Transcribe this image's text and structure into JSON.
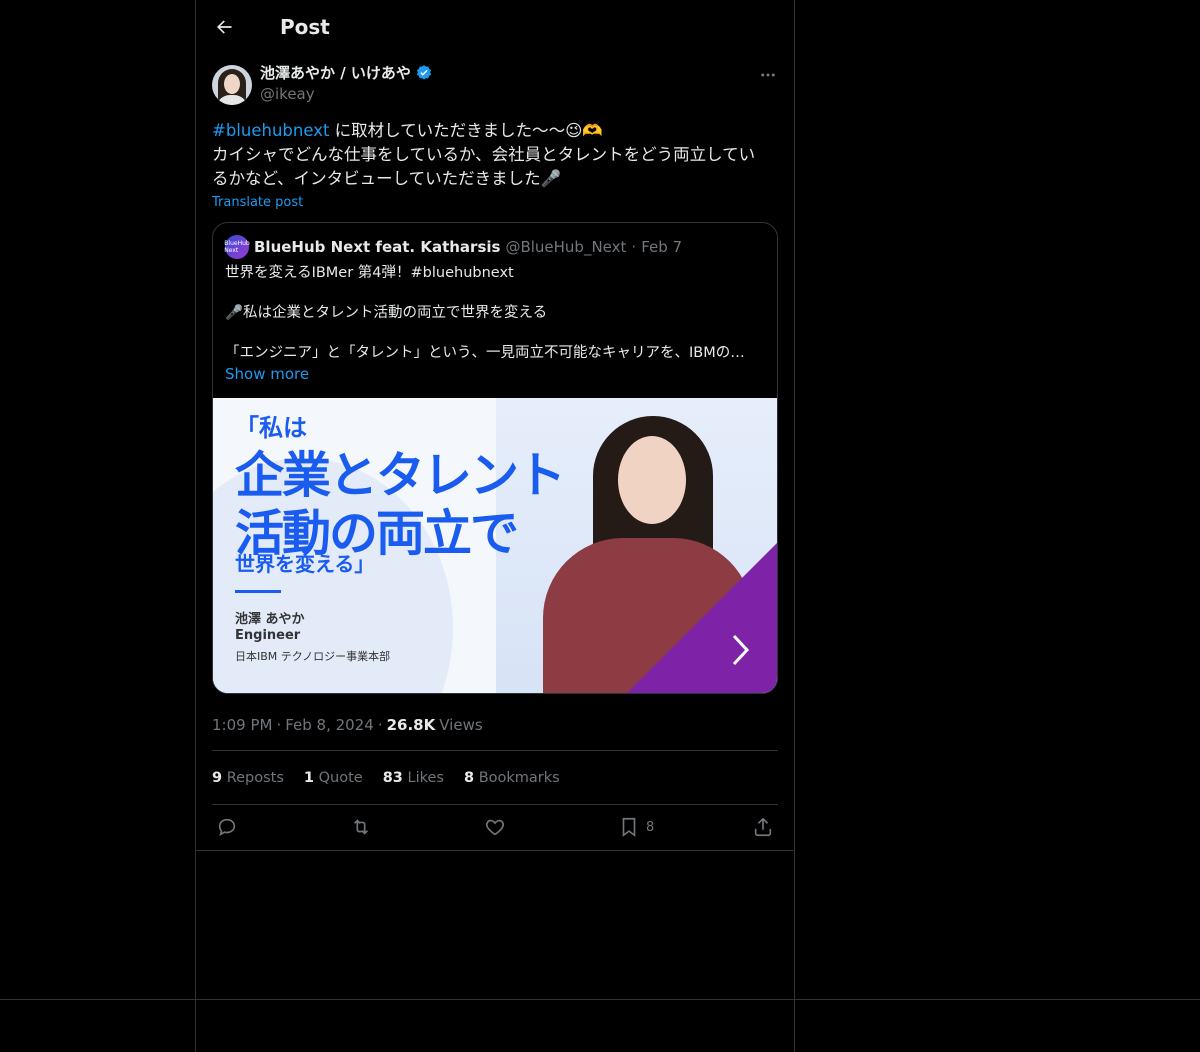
{
  "header": {
    "title": "Post"
  },
  "author": {
    "name": "池澤あやか / いけあや",
    "handle": "@ikeay",
    "verified": true
  },
  "post": {
    "hashtag": "#bluehubnext",
    "line1_rest": " に取材していただきました〜〜😉🫶",
    "line2": "カイシャでどんな仕事をしているか、会社員とタレントをどう両立してい",
    "line3": "るかなど、インタビューしていただきました🎤",
    "translate_label": "Translate post"
  },
  "quote": {
    "name": "BlueHub Next feat. Katharsis",
    "handle": "@BlueHub_Next",
    "separator": "·",
    "date": "Feb 7",
    "avatar_text": "BlueHub Next",
    "line1": "世界を変えるIBMer 第4弾！#bluehubnext",
    "line2": "🎤私は企業とタレント活動の両立で世界を変える",
    "line3": "「エンジニア」と「タレント」という、一見両立不可能なキャリアを、IBMの…",
    "show_more": "Show more"
  },
  "banner": {
    "open_quote": "「私は",
    "line1": "企業とタレント",
    "line2": "活動の両立で",
    "line3": "世界を変える」",
    "name": "池澤 あやか",
    "role": "Engineer",
    "dept": "日本IBM テクノロジー事業本部"
  },
  "meta": {
    "time": "1:09 PM",
    "sep1": "·",
    "date": "Feb 8, 2024",
    "sep2": "·",
    "views_count": "26.8K",
    "views_label": "Views"
  },
  "stats": {
    "reposts_count": "9",
    "reposts_label": "Reposts",
    "quotes_count": "1",
    "quotes_label": "Quote",
    "likes_count": "83",
    "likes_label": "Likes",
    "bookmarks_count": "8",
    "bookmarks_label": "Bookmarks"
  },
  "actions": {
    "bookmark_count": "8"
  },
  "colors": {
    "accent": "#1d9bf0",
    "background": "#000000",
    "border": "#2f3336",
    "muted_text": "#71767b",
    "banner_blue": "#1a5cf0",
    "banner_purple": "#7e22a8"
  },
  "icons": [
    "back-arrow-icon",
    "verified-badge-icon",
    "more-icon",
    "reply-icon",
    "repost-icon",
    "like-icon",
    "bookmark-icon",
    "share-icon",
    "chevron-right-icon"
  ]
}
